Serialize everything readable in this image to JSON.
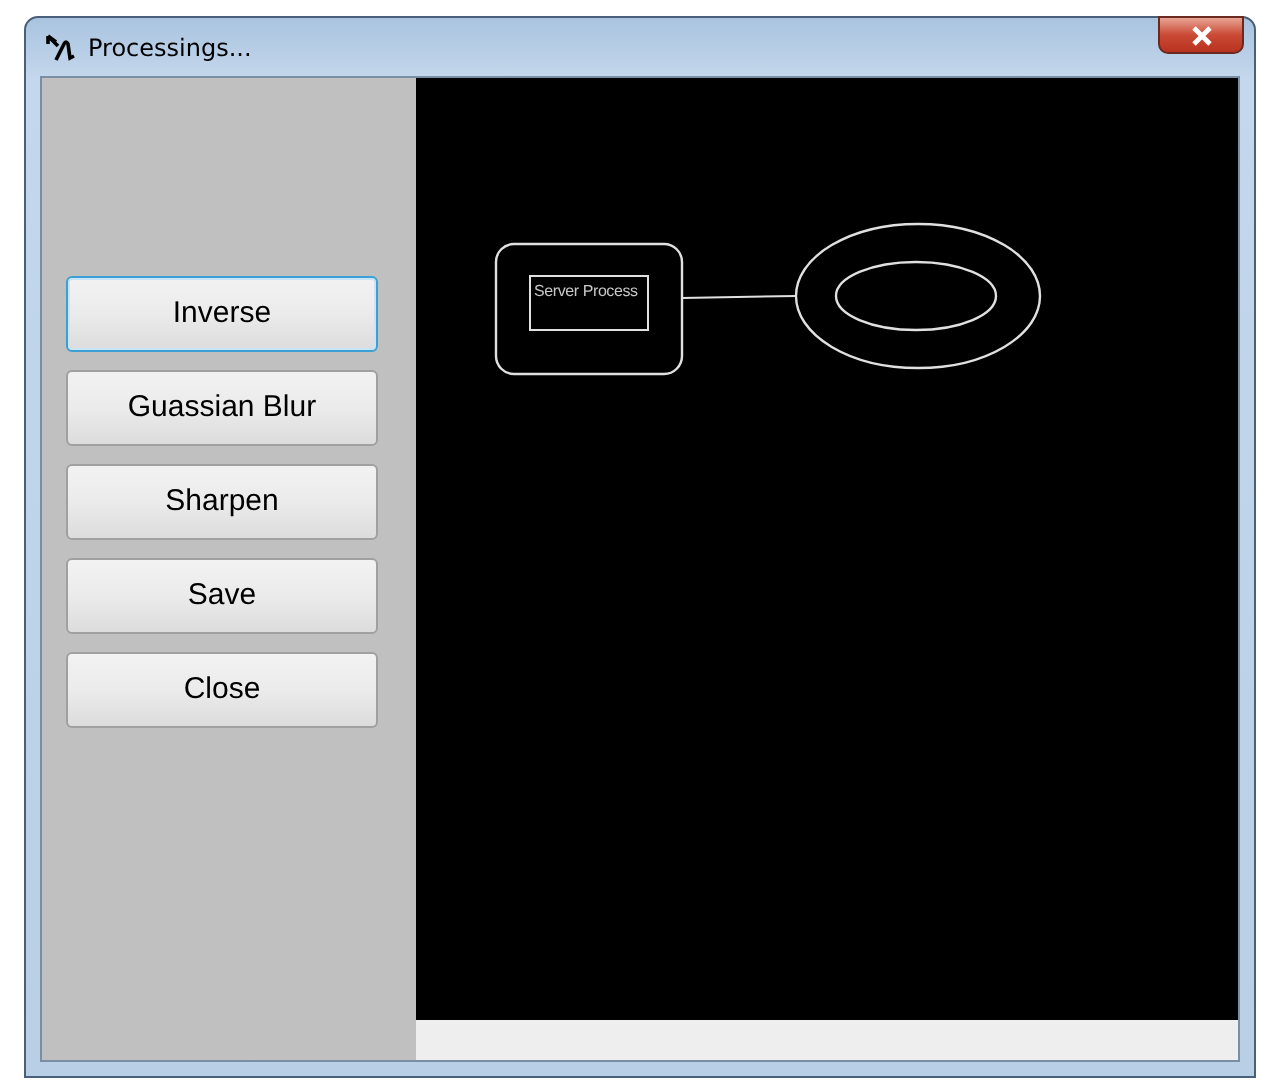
{
  "window": {
    "title": "Processings..."
  },
  "buttons": [
    {
      "label": "Inverse",
      "focused": true
    },
    {
      "label": "Guassian Blur",
      "focused": false
    },
    {
      "label": "Sharpen",
      "focused": false
    },
    {
      "label": "Save",
      "focused": false
    },
    {
      "label": "Close",
      "focused": false
    }
  ],
  "canvas": {
    "node_label": "Server Process"
  }
}
